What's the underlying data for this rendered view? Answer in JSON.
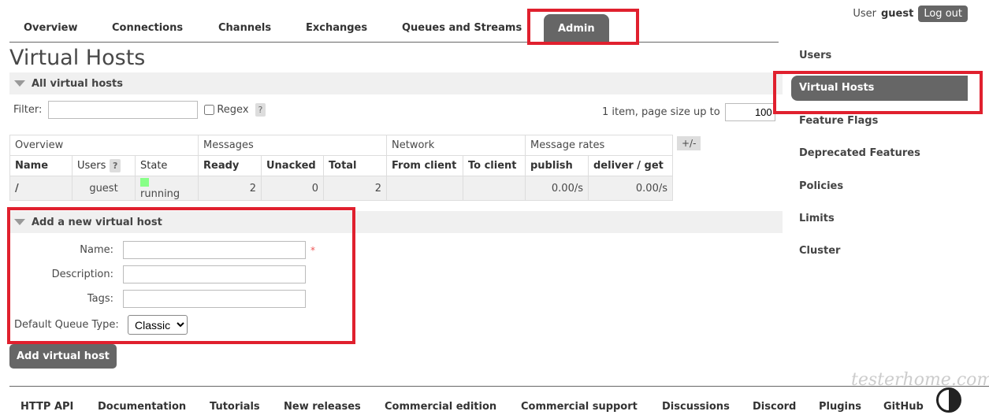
{
  "nav": {
    "tabs": [
      "Overview",
      "Connections",
      "Channels",
      "Exchanges",
      "Queues and Streams",
      "Admin"
    ],
    "active": "Admin"
  },
  "user": {
    "prefix": "User",
    "name": "guest",
    "logout": "Log out"
  },
  "page_title": "Virtual Hosts",
  "all_vhosts": {
    "title": "All virtual hosts",
    "filter_label": "Filter:",
    "filter_value": "",
    "regex_label": "Regex",
    "help": "?",
    "pagination_text": "1 item, page size up to",
    "page_size": "100",
    "table": {
      "groups": [
        "Overview",
        "Messages",
        "Network",
        "Message rates"
      ],
      "columns": [
        "Name",
        "Users",
        "State",
        "Ready",
        "Unacked",
        "Total",
        "From client",
        "To client",
        "publish",
        "deliver / get"
      ],
      "users_help": "?",
      "toggle_columns": "+/-",
      "rows": [
        {
          "name": "/",
          "users": "guest",
          "state": "running",
          "ready": "2",
          "unacked": "0",
          "total": "2",
          "from_client": "",
          "to_client": "",
          "publish": "0.00/s",
          "deliver_get": "0.00/s"
        }
      ]
    }
  },
  "add_vhost": {
    "title": "Add a new virtual host",
    "name_label": "Name:",
    "description_label": "Description:",
    "tags_label": "Tags:",
    "queue_type_label": "Default Queue Type:",
    "queue_type_value": "Classic",
    "required_mark": "*",
    "submit": "Add virtual host"
  },
  "sidebar": [
    "Users",
    "Virtual Hosts",
    "Feature Flags",
    "Deprecated Features",
    "Policies",
    "Limits",
    "Cluster"
  ],
  "footer": [
    "HTTP API",
    "Documentation",
    "Tutorials",
    "New releases",
    "Commercial edition",
    "Commercial support",
    "Discussions",
    "Discord",
    "Plugins",
    "GitHub"
  ],
  "watermark": "testerhome.com",
  "colors": {
    "highlight": "#e0202e",
    "active_tab": "#666666",
    "running": "#88ff88"
  }
}
